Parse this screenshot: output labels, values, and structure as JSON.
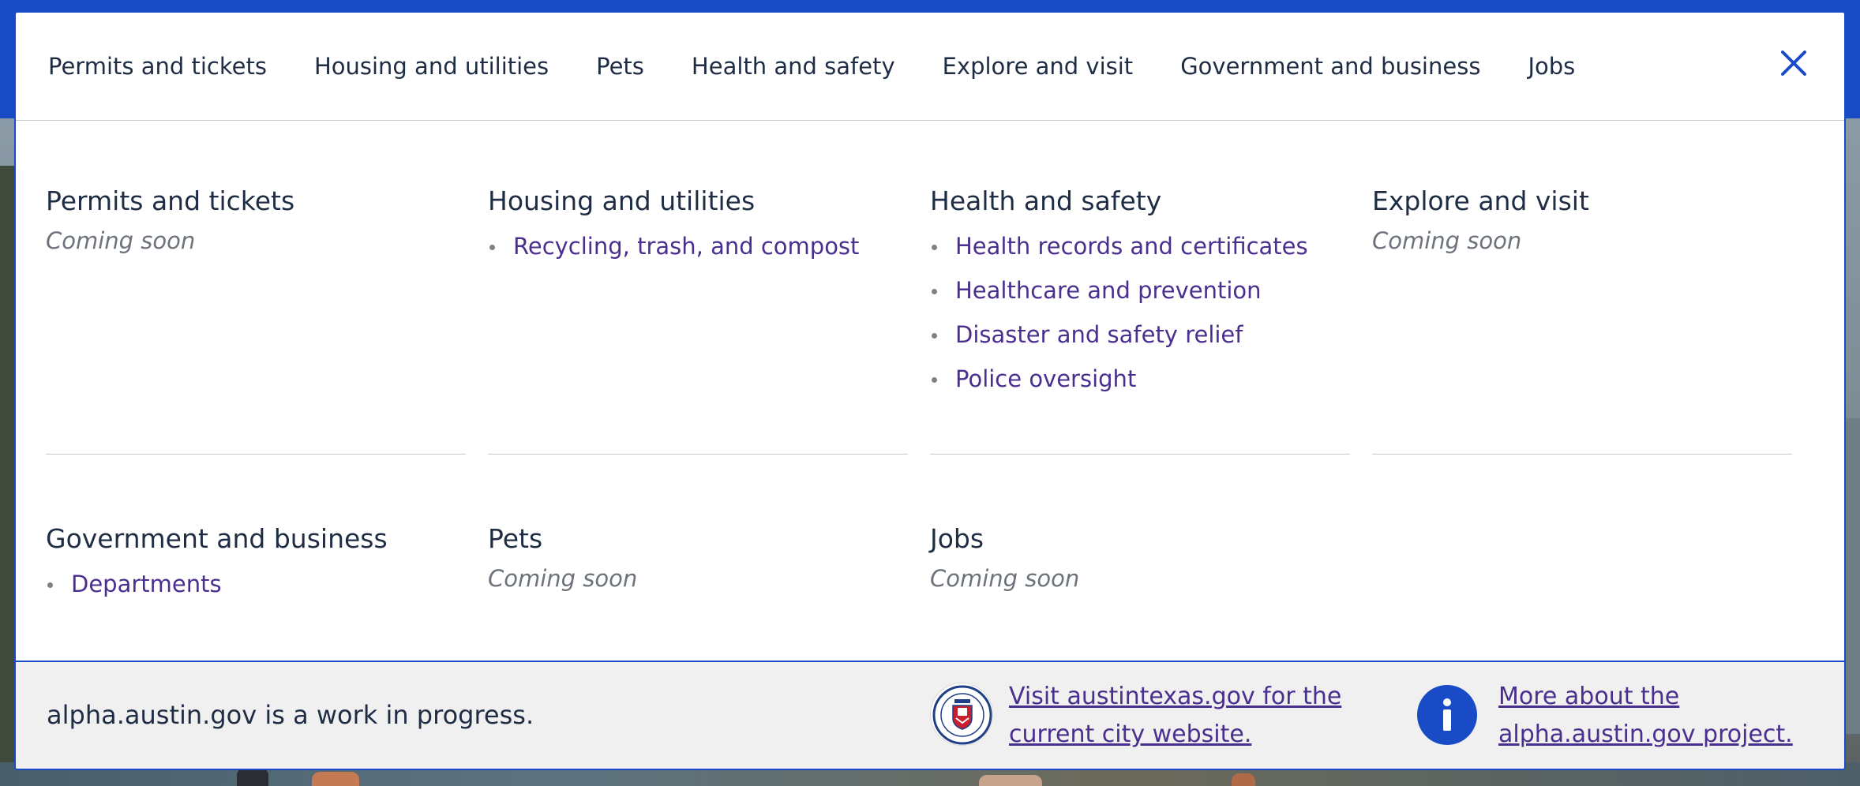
{
  "colors": {
    "brand_blue": "#1a4bc6",
    "heading_text": "#1f2d44",
    "link_purple": "#4a2f8e",
    "muted_text": "#6c737a",
    "footer_bg": "#f0f0f0"
  },
  "topnav": {
    "items": [
      {
        "label": "Permits and tickets"
      },
      {
        "label": "Housing and utilities"
      },
      {
        "label": "Pets"
      },
      {
        "label": "Health and safety"
      },
      {
        "label": "Explore and visit"
      },
      {
        "label": "Government and business"
      },
      {
        "label": "Jobs"
      }
    ],
    "close_icon": "close-icon"
  },
  "menu": {
    "sections": [
      {
        "title": "Permits and tickets",
        "status": "Coming soon",
        "links": []
      },
      {
        "title": "Housing and utilities",
        "status": "",
        "links": [
          "Recycling, trash, and compost"
        ]
      },
      {
        "title": "Health and safety",
        "status": "",
        "links": [
          "Health records and certificates",
          "Healthcare and prevention",
          "Disaster and safety relief",
          "Police oversight"
        ]
      },
      {
        "title": "Explore and visit",
        "status": "Coming soon",
        "links": []
      },
      {
        "title": "Government and business",
        "status": "",
        "links": [
          "Departments"
        ]
      },
      {
        "title": "Pets",
        "status": "Coming soon",
        "links": []
      },
      {
        "title": "Jobs",
        "status": "Coming soon",
        "links": []
      }
    ]
  },
  "footer": {
    "wip_text": "alpha.austin.gov is a work in progress.",
    "seal_icon": "city-seal-icon",
    "city_link": "Visit austintexas.gov for the current city website.",
    "info_icon": "info-icon",
    "about_link": "More about the alpha.austin.gov project."
  }
}
